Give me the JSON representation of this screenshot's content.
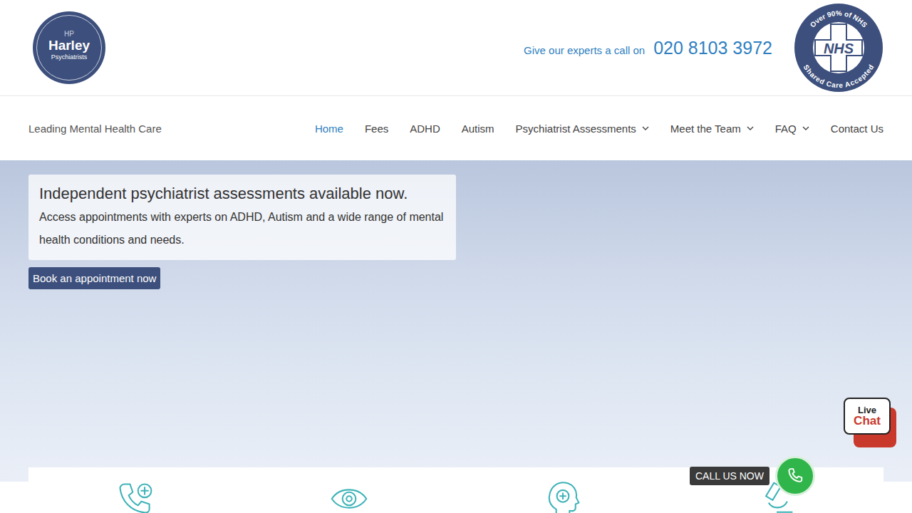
{
  "logo": {
    "mark": "HP",
    "name": "Harley",
    "subtitle": "Psychiatrists"
  },
  "contact": {
    "prompt": "Give our experts a call on",
    "phone": "020 8103 3972"
  },
  "nhs_badge": {
    "top": "Over 90% of NHS",
    "center": "NHS",
    "bottom": "Shared Care Accepted"
  },
  "tagline": "Leading Mental Health Care",
  "nav": [
    {
      "label": "Home",
      "selected": true,
      "dropdown": false
    },
    {
      "label": "Fees",
      "selected": false,
      "dropdown": false
    },
    {
      "label": "ADHD",
      "selected": false,
      "dropdown": false
    },
    {
      "label": "Autism",
      "selected": false,
      "dropdown": false
    },
    {
      "label": "Psychiatrist Assessments",
      "selected": false,
      "dropdown": true
    },
    {
      "label": "Meet the Team",
      "selected": false,
      "dropdown": true
    },
    {
      "label": "FAQ",
      "selected": false,
      "dropdown": true
    },
    {
      "label": "Contact Us",
      "selected": false,
      "dropdown": false
    }
  ],
  "hero": {
    "title": "Independent psychiatrist assessments available now.",
    "text": "Access appointments with experts on ADHD, Autism and a wide range of mental health conditions and needs.",
    "button": "Book an appointment now"
  },
  "live_chat": {
    "line1": "Live",
    "line2": "Chat"
  },
  "call_now": "CALL US NOW"
}
